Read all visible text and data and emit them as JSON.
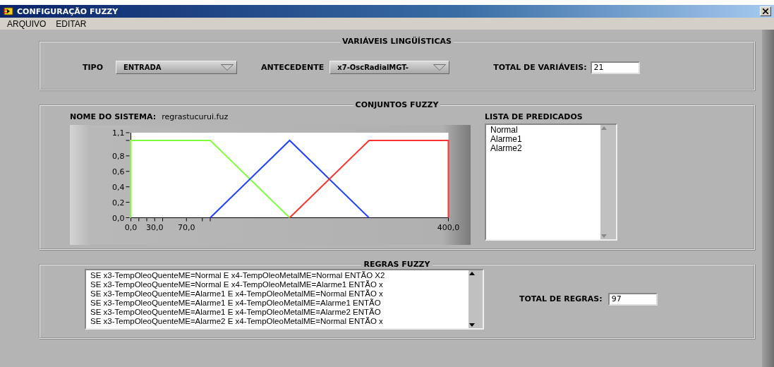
{
  "window": {
    "title": "CONFIGURAÇÃO FUZZY"
  },
  "menu": [
    "ARQUIVO",
    "EDITAR"
  ],
  "variables_panel": {
    "title": "VARIÁVEIS LINGÜÍSTICAS",
    "type_label": "TIPO",
    "type_value": "ENTRADA",
    "antecedent_label": "ANTECEDENTE",
    "antecedent_value": "x7-OscRadialMGT-",
    "total_label": "TOTAL DE VARIÁVEIS:",
    "total_value": "21"
  },
  "sets_panel": {
    "title": "CONJUNTOS FUZZY",
    "system_label": "NOME DO SISTEMA:",
    "system_value": "regrastucurui.fuz",
    "chart_data": {
      "type": "line",
      "x": [
        0,
        0,
        100,
        200,
        300,
        400,
        400
      ],
      "series": [
        {
          "color": "#80ff40",
          "values": [
            0,
            1,
            1,
            0,
            null,
            null,
            null
          ]
        },
        {
          "color": "#2040ff",
          "values": [
            null,
            null,
            0,
            1,
            0,
            null,
            null
          ]
        },
        {
          "color": "#ff3030",
          "values": [
            null,
            null,
            null,
            0,
            1,
            1,
            0
          ]
        }
      ],
      "xlim": [
        0,
        400
      ],
      "ylim": [
        0,
        1.1
      ],
      "xticks": [
        {
          "value": 0,
          "label": "0,0"
        },
        {
          "value": 30,
          "label": "30,0"
        },
        {
          "value": 70,
          "label": "70,0"
        },
        {
          "value": 400,
          "label": "400,0"
        }
      ],
      "yticks": [
        {
          "value": 0,
          "label": "0,0"
        },
        {
          "value": 0.2,
          "label": "0,2"
        },
        {
          "value": 0.4,
          "label": "0,4"
        },
        {
          "value": 0.6,
          "label": "0,6"
        },
        {
          "value": 0.8,
          "label": "0,8"
        },
        {
          "value": 1.1,
          "label": "1,1"
        }
      ]
    },
    "predicates_label": "LISTA DE PREDICADOS",
    "predicates": [
      "Normal",
      "Alarme1",
      "Alarme2"
    ]
  },
  "rules_panel": {
    "title": "REGRAS FUZZY",
    "rules": [
      "SE x3-TempOleoQuenteME=Normal E x4-TempOleoMetalME=Normal ENTÃO X2",
      "SE x3-TempOleoQuenteME=Normal E x4-TempOleoMetalME=Alarme1 ENTÃO x",
      "SE x3-TempOleoQuenteME=Alarme1 E x4-TempOleoMetalME=Normal ENTÃO x",
      "SE x3-TempOleoQuenteME=Alarme1 E x4-TempOleoMetalME=Alarme1 ENTÃO",
      "SE x3-TempOleoQuenteME=Alarme1 E x4-TempOleoMetalME=Alarme2 ENTÃO",
      "SE x3-TempOleoQuenteME=Alarme2 E x4-TempOleoMetalME=Normal ENTÃO x"
    ],
    "total_label": "TOTAL DE REGRAS:",
    "total_value": "97"
  }
}
